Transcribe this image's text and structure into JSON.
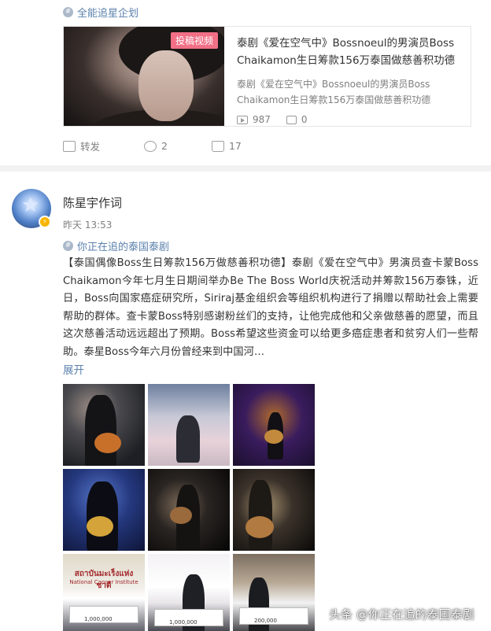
{
  "top_topic": {
    "icon": "topic-icon",
    "label": "全能追星企划"
  },
  "card": {
    "tag": "投稿视频",
    "title": "泰剧《爱在空气中》Bossnoeul的男演员Boss Chaikamon生日筹款156万泰国做慈善积功德",
    "desc": "泰剧《爱在空气中》Bossnoeul的男演员Boss Chaikamon生日筹款156万泰国做慈善积功德",
    "views": "987",
    "comments": "0"
  },
  "actions": {
    "share": "转发",
    "comment": "2",
    "like": "17"
  },
  "post": {
    "author": "陈星宇作词",
    "time": "昨天 13:53",
    "topic": "你正在追的泰国泰剧",
    "text": "【泰国偶像Boss生日筹款156万做慈善积功德】泰剧《爱在空气中》男演员查卡蒙Boss Chaikamon今年七月生日期间举办Be The Boss World庆祝活动并筹款156万泰铢，近日，Boss向国家癌症研究所，Siriraj基金组织会等组织机构进行了捐赠以帮助社会上需要帮助的群体。查卡蒙Boss特别感谢粉丝们的支持，让他完成他和父亲做慈善的愿望，而且这次慈善活动远远超出了预期。Boss希望这些资金可以给更多癌症患者和贫穷人们一些帮助。泰星Boss今年六月份曾经来到中国河…",
    "expand": "展开"
  },
  "photos": {
    "p7_banner": "สถาบันมะเร็งแห่งชาติ",
    "p7_sub": "National Cancer Institute",
    "p7_cheque": "1,000,000",
    "p8_cheque": "1,000,000",
    "p9_cheque": "200,000"
  },
  "watermark": "头条 @你正在追的泰国泰剧",
  "colors": {
    "link": "#5d82ad",
    "tag": "#f26f86",
    "verified": "#f7b500"
  }
}
